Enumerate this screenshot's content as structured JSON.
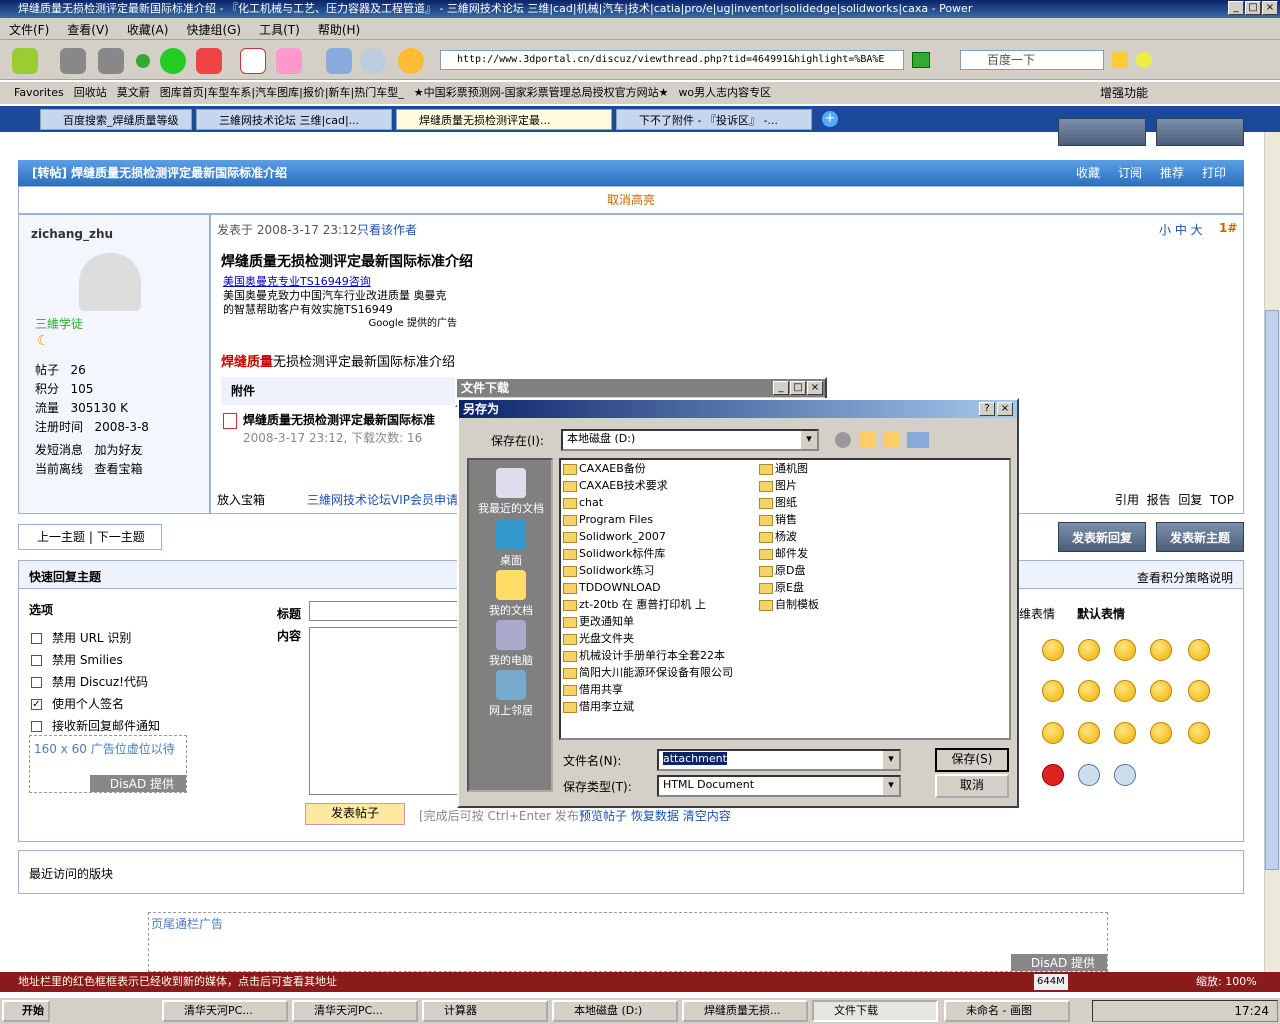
{
  "window": {
    "title": "焊缝质量无损检测评定最新国际标准介绍 - 『化工机械与工艺、压力容器及工程管道』 - 三維网技术论坛 三维|cad|机械|汽车|技术|catia|pro/e|ug|inventor|solidedge|solidworks|caxa - Power"
  },
  "menu": [
    "文件(F)",
    "查看(V)",
    "收藏(A)",
    "快捷组(G)",
    "工具(T)",
    "帮助(H)"
  ],
  "address": {
    "url": "http://www.3dportal.cn/discuz/viewthread.php?tid=464991&highlight=%BA%E"
  },
  "search": {
    "value": "百度一下"
  },
  "favorites": [
    "Favorites",
    "回收站",
    "莫文蔚",
    "图库首页|车型车系|汽车图库|报价|新车|热门车型_",
    "★中国彩票预测网-国家彩票管理总局授权官方网站★",
    "wo男人志内容专区"
  ],
  "favbar_right": "增强功能",
  "tabs": [
    "百度搜索_焊缝质量等级",
    "三維网技术论坛 三维|cad|...",
    "焊缝质量无损检测评定最...",
    "下不了附件 - 『投诉区』 -..."
  ],
  "post": {
    "header": "[转帖] 焊缝质量无损检测评定最新国际标准介绍",
    "actions": [
      "收藏",
      "订阅",
      "推荐",
      "打印"
    ],
    "cancel_highlight": "取消高亮",
    "author": "zichang_zhu",
    "rank": "三維学徒",
    "stats": [
      {
        "k": "帖子",
        "v": "26"
      },
      {
        "k": "积分",
        "v": "105"
      },
      {
        "k": "流量",
        "v": "305130 K"
      },
      {
        "k": "注册时间",
        "v": "2008-3-8"
      }
    ],
    "links": [
      "发短消息",
      "加为好友",
      "当前离线",
      "查看宝箱"
    ],
    "posted": "发表于  2008-3-17 23:12",
    "only_author": "只看该作者",
    "font_sizes": "小 中 大",
    "floor": "1#",
    "title": "焊缝质量无损检测评定最新国际标准介绍",
    "ad_link": "美国奥曼克专业TS16949咨询",
    "ad_text": "美国奥曼克致力中国汽车行业改进质量 奥曼克的智慧帮助客户有效实施TS16949",
    "ad_google": "Google 提供的广告",
    "body_hl": "焊缝质量",
    "body_rest": "无损检测评定最新国际标准介绍",
    "attach_label": "附件",
    "attach_name": "焊缝质量无损检测评定最新国际标准",
    "attach_meta": "2008-3-17 23:12, 下载次数: 16",
    "footer_left": "放入宝箱",
    "footer_ad": "三維网技术论坛VIP会员申请",
    "footer_right": [
      "引用",
      "报告",
      "回复",
      "TOP"
    ]
  },
  "nav": {
    "prev": "上一主题",
    "next": "下一主题"
  },
  "buttons": {
    "reply": "发表新回复",
    "topic": "发表新主题"
  },
  "quick": {
    "title": "快速回复主题",
    "policy": "查看积分策略说明",
    "options": "选项",
    "checks": [
      {
        "label": "禁用 URL 识别",
        "checked": false
      },
      {
        "label": "禁用 Smilies",
        "checked": false
      },
      {
        "label": "禁用 Discuz!代码",
        "checked": false
      },
      {
        "label": "使用个人签名",
        "checked": true
      },
      {
        "label": "接收新回复邮件通知",
        "checked": false
      }
    ],
    "ad_placeholder": "160 x 60 广告位虚位以待",
    "disad": "DisAD 提供",
    "subject_label": "标题",
    "content_label": "内容",
    "emoji_tabs": [
      "维表情",
      "默认表情"
    ],
    "submit": "发表帖子",
    "hint": "[完成后可按 Ctrl+Enter 发布]",
    "tools": [
      "预览帖子",
      "恢复数据",
      "清空内容"
    ]
  },
  "recent": "最近访问的版块",
  "footer_ad": "页尾通栏广告",
  "footer_disad": "DisAD 提供",
  "dl_window": {
    "title": "文件下载"
  },
  "saveas": {
    "title": "另存为",
    "savein_label": "保存在(I):",
    "savein_value": "本地磁盘 (D:)",
    "places": [
      "我最近的文档",
      "桌面",
      "我的文档",
      "我的电脑",
      "网上邻居"
    ],
    "folders_col1": [
      "CAXAEB备份",
      "CAXAEB技术要求",
      "chat",
      "Program Files",
      "Solidwork_2007",
      "Solidwork标件库",
      "Solidwork练习",
      "TDDOWNLOAD",
      "zt-20tb 在 惠普打印机 上",
      "更改通知单",
      "光盘文件夹",
      "机械设计手册单行本全套22本",
      "简阳大川能源环保设备有限公司",
      "借用共享",
      "借用李立斌"
    ],
    "folders_col2": [
      "通机图",
      "图片",
      "图纸",
      "销售",
      "杨波",
      "邮件发",
      "原D盘",
      "原E盘",
      "自制模板"
    ],
    "filename_label": "文件名(N):",
    "filename_value": "attachment",
    "type_label": "保存类型(T):",
    "type_value": "HTML Document",
    "save": "保存(S)",
    "cancel": "取消"
  },
  "statusbar": "地址栏里的红色框框表示已经收到新的媒体，点击后可查看其地址",
  "statusbar_right": "缩放: 100%",
  "statusbar_mem": "644M",
  "taskbar": {
    "start": "开始",
    "tasks": [
      "清华天河PC...",
      "清华天河PC...",
      "计算器",
      "本地磁盘 (D:)",
      "焊缝质量无损...",
      "文件下载",
      "未命名 - 画图"
    ],
    "clock": "17:24"
  }
}
